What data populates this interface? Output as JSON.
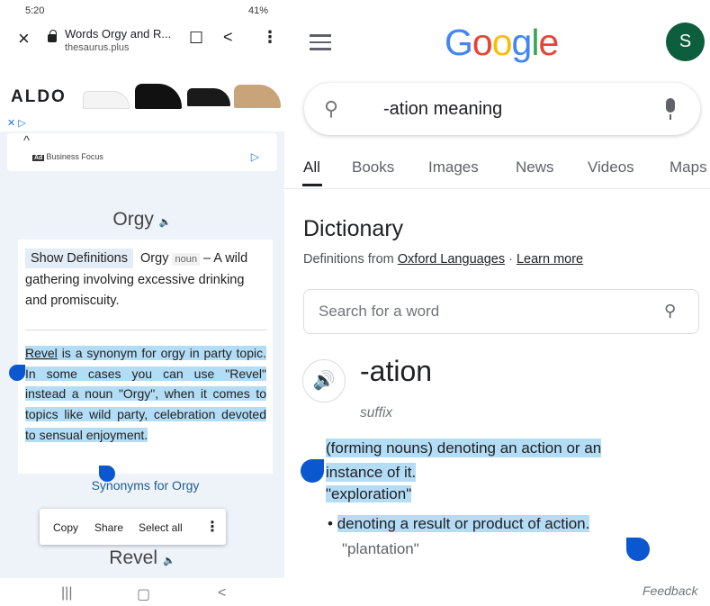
{
  "left": {
    "status": {
      "time": "5:20",
      "right": "41%"
    },
    "browser": {
      "title": "Words Orgy and R...",
      "host": "thesaurus.plus"
    },
    "ad": {
      "brand": "ALDO",
      "advertiser": "Business Focus",
      "ad_label": "Ad"
    },
    "headword": "Orgy",
    "show_definitions": "Show Definitions",
    "def_word": "Orgy",
    "def_pos": "noun",
    "def_text": "– A wild gathering involving excessive drinking and promiscuity.",
    "synonym_link": "Revel",
    "synonym_text": " is a synonym for orgy in party topic. In some cases you can use \"Revel\" instead a noun \"Orgy\", when it comes to topics like wild party, celebration devoted to sensual enjoyment.",
    "synonyms_label": "Synonyms for Orgy",
    "popup": {
      "copy": "Copy",
      "share": "Share",
      "select_all": "Select all"
    },
    "next_word": "Revel"
  },
  "right": {
    "avatar_letter": "S",
    "query": "-ation meaning",
    "tabs": [
      "All",
      "Books",
      "Images",
      "News",
      "Videos",
      "Maps"
    ],
    "dictionary_title": "Dictionary",
    "definitions_from": "Definitions from",
    "source": "Oxford Languages",
    "sep": " · ",
    "learn_more": "Learn more",
    "search_placeholder": "Search for a word",
    "word": "-ation",
    "part_of_speech": "suffix",
    "definition": "(forming nouns) denoting an action or an instance of it.",
    "example1": "\"exploration\"",
    "sub_definition": "denoting a result or product of action.",
    "example2": "\"plantation\"",
    "feedback": "Feedback"
  },
  "colors": {
    "accent": "#1a73e8",
    "highlight": "#b3dcf5",
    "handle": "#0b57d0",
    "avatar": "#0d5e3c"
  }
}
